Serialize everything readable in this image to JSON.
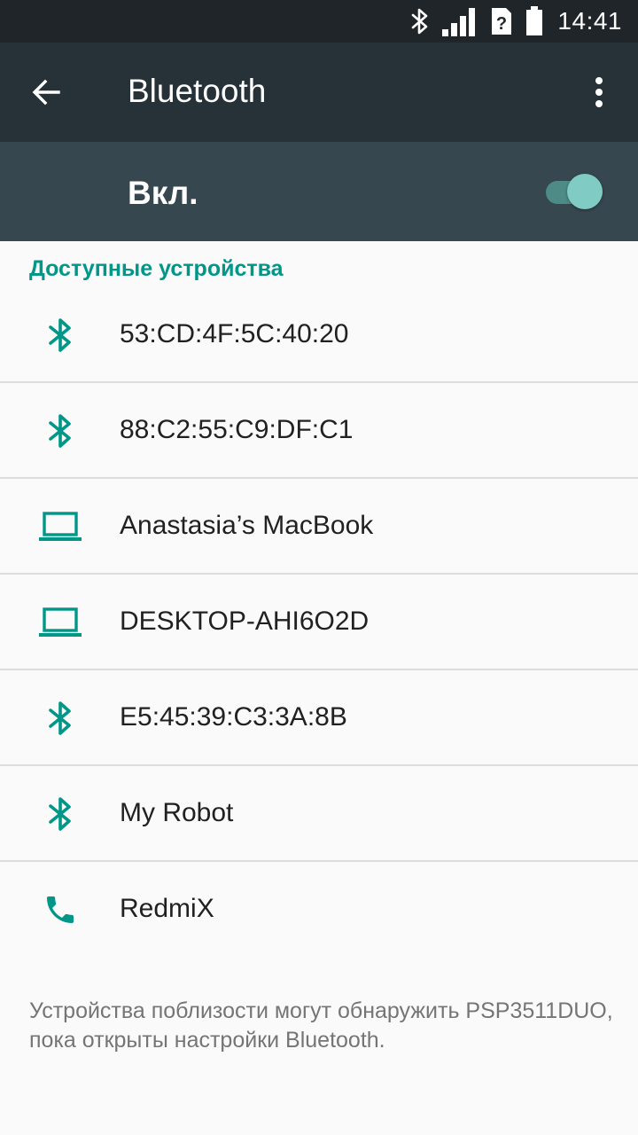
{
  "status_bar": {
    "time": "14:41",
    "icons": [
      "bluetooth-icon",
      "signal-icon",
      "no-sim-icon",
      "battery-icon"
    ]
  },
  "toolbar": {
    "title": "Bluetooth",
    "back_icon": "arrow-back-icon",
    "more_icon": "more-vert-icon"
  },
  "switch_bar": {
    "label": "Вкл.",
    "state": "on"
  },
  "section": {
    "header": "Доступные устройства"
  },
  "devices": [
    {
      "name": "53:CD:4F:5C:40:20",
      "icon": "bluetooth-icon"
    },
    {
      "name": "88:C2:55:C9:DF:C1",
      "icon": "bluetooth-icon"
    },
    {
      "name": "Anastasia’s MacBook",
      "icon": "laptop-icon"
    },
    {
      "name": "DESKTOP-AHI6O2D",
      "icon": "laptop-icon"
    },
    {
      "name": "E5:45:39:C3:3A:8B",
      "icon": "bluetooth-icon"
    },
    {
      "name": "My Robot",
      "icon": "bluetooth-icon"
    },
    {
      "name": "RedmiX",
      "icon": "phone-icon"
    }
  ],
  "footer": {
    "text": "Устройства поблизости могут обнаружить PSP3511DUO, пока открыты настройки Bluetooth."
  },
  "colors": {
    "accent": "#009688",
    "toolbar": "#263238",
    "switch_bar": "#37474f",
    "status_bar": "#1f2528"
  }
}
